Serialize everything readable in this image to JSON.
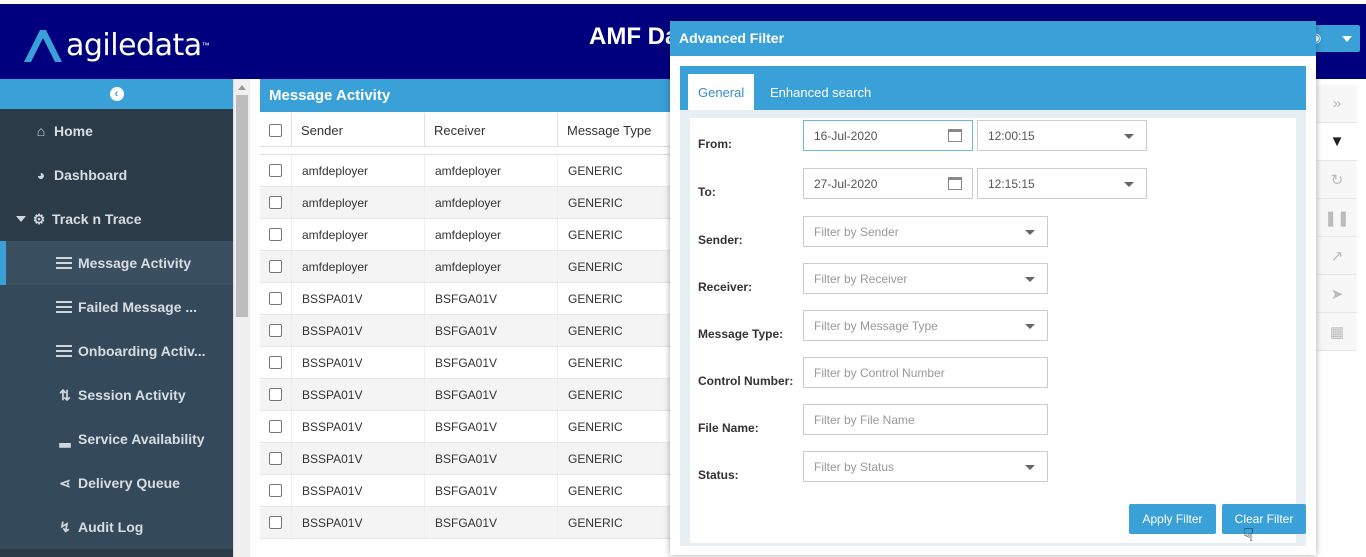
{
  "header": {
    "logo_text": "agiledata",
    "logo_tm": "™",
    "title": "AMF Da",
    "user_icon": "help-icon"
  },
  "sidebar": {
    "items": [
      {
        "label": "Home",
        "icon": "home-icon"
      },
      {
        "label": "Dashboard",
        "icon": "dashboard-icon"
      },
      {
        "label": "Track n Trace",
        "icon": "cogs-icon"
      },
      {
        "label": "Message Activity",
        "icon": "list-icon"
      },
      {
        "label": "Failed Message ...",
        "icon": "list-icon"
      },
      {
        "label": "Onboarding Activ...",
        "icon": "list-icon"
      },
      {
        "label": "Session Activity",
        "icon": "sort-icon"
      },
      {
        "label": "Service Availability",
        "icon": "signal-icon"
      },
      {
        "label": "Delivery Queue",
        "icon": "share-icon"
      },
      {
        "label": "Audit Log",
        "icon": "bolt-icon"
      }
    ]
  },
  "main": {
    "panel_title": "Message Activity",
    "columns": [
      "Sender",
      "Receiver",
      "Message Type"
    ],
    "rows": [
      [
        "amfdeployer",
        "amfdeployer",
        "GENERIC"
      ],
      [
        "amfdeployer",
        "amfdeployer",
        "GENERIC"
      ],
      [
        "amfdeployer",
        "amfdeployer",
        "GENERIC"
      ],
      [
        "amfdeployer",
        "amfdeployer",
        "GENERIC"
      ],
      [
        "BSSPA01V",
        "BSFGA01V",
        "GENERIC"
      ],
      [
        "BSSPA01V",
        "BSFGA01V",
        "GENERIC"
      ],
      [
        "BSSPA01V",
        "BSFGA01V",
        "GENERIC"
      ],
      [
        "BSSPA01V",
        "BSFGA01V",
        "GENERIC"
      ],
      [
        "BSSPA01V",
        "BSFGA01V",
        "GENERIC"
      ],
      [
        "BSSPA01V",
        "BSFGA01V",
        "GENERIC"
      ],
      [
        "BSSPA01V",
        "BSFGA01V",
        "GENERIC"
      ],
      [
        "BSSPA01V",
        "BSFGA01V",
        "GENERIC"
      ]
    ]
  },
  "toolbar": {
    "buttons": [
      "expand-icon",
      "filter-icon",
      "refresh-icon",
      "pause-icon",
      "export-icon",
      "forward-icon",
      "file-icon"
    ]
  },
  "dialog": {
    "title": "Advanced Filter",
    "tabs": [
      "General",
      "Enhanced search"
    ],
    "fields": {
      "from_label": "From:",
      "from_date": "16-Jul-2020",
      "from_time": "12:00:15",
      "to_label": "To:",
      "to_date": "27-Jul-2020",
      "to_time": "12:15:15",
      "sender_label": "Sender:",
      "sender_placeholder": "Filter by Sender",
      "receiver_label": "Receiver:",
      "receiver_placeholder": "Filter by Receiver",
      "msgtype_label": "Message Type:",
      "msgtype_placeholder": "Filter by Message Type",
      "control_label": "Control Number:",
      "control_placeholder": "Filter by Control Number",
      "file_label": "File Name:",
      "file_placeholder": "Filter by File Name",
      "status_label": "Status:",
      "status_placeholder": "Filter by Status"
    },
    "apply_label": "Apply Filter",
    "clear_label": "Clear Filter"
  }
}
